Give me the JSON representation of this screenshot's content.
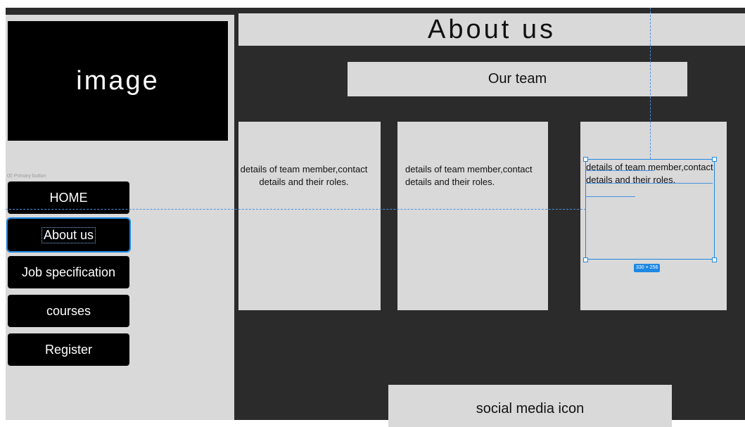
{
  "frame": {
    "name": ""
  },
  "sidebar": {
    "image_label": "image",
    "component_label": "00 Primary button",
    "nav": [
      {
        "label": "HOME"
      },
      {
        "label": "About us"
      },
      {
        "label": "Job specification"
      },
      {
        "label": "courses"
      },
      {
        "label": "Register"
      }
    ]
  },
  "main": {
    "title": "About us",
    "subtitle": "Our team",
    "cards": [
      {
        "text": "details of team member,contact details and their roles."
      },
      {
        "text": "details of team member,contact details and their roles."
      },
      {
        "text": "details of team member,contact details and their roles."
      }
    ],
    "social_label": "social media icon"
  },
  "selection": {
    "dimensions": "330 × 256"
  },
  "colors": {
    "canvas": "#2b2b2b",
    "panel": "#d9d9d9",
    "button": "#000000",
    "selection": "#1e88e5"
  }
}
